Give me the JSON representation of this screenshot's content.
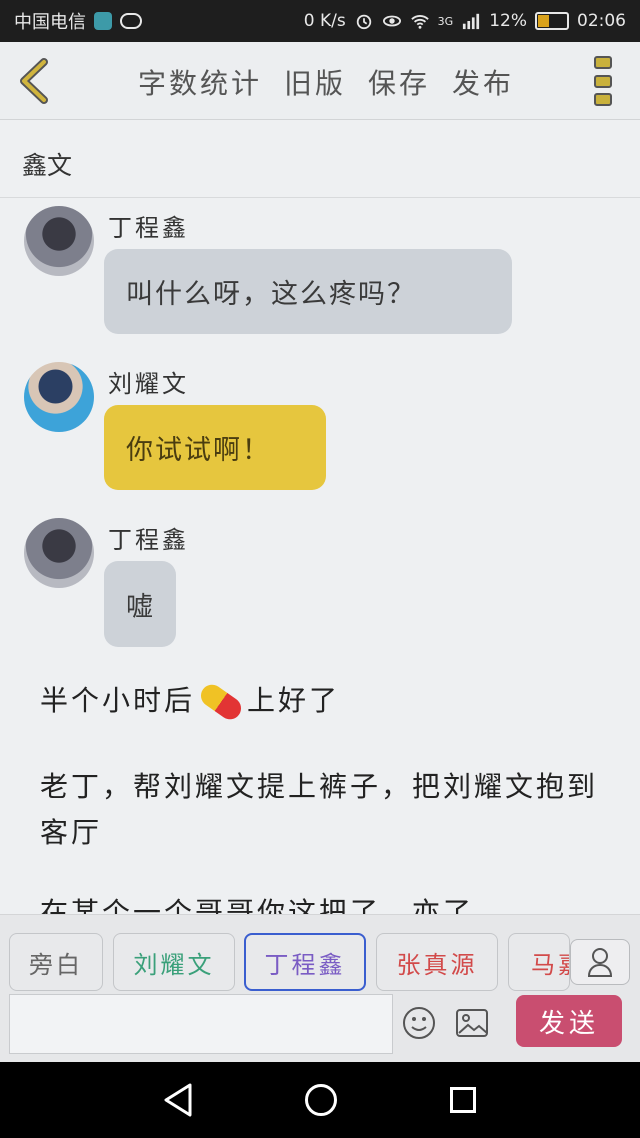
{
  "status_bar": {
    "carrier": "中国电信",
    "speed": "0 K/s",
    "network": "3G",
    "battery": "12%",
    "time": "02:06"
  },
  "header": {
    "actions": [
      "字数统计",
      "旧版",
      "保存",
      "发布"
    ]
  },
  "story_title": "鑫文",
  "messages": [
    {
      "sender": "丁程鑫",
      "text": "叫什么呀，这么疼吗？"
    },
    {
      "sender": "刘耀文",
      "text": "你试试啊！"
    },
    {
      "sender": "丁程鑫",
      "text": "嘘"
    }
  ],
  "narration": [
    {
      "before": "半个小时后",
      "after": "上好了"
    },
    {
      "text": "老丁，帮刘耀文提上裤子，把刘耀文抱到客厅"
    },
    {
      "text": "在某个一个哥哥你这把了，亦了"
    }
  ],
  "characters": [
    {
      "label": "旁白",
      "color": "#666666"
    },
    {
      "label": "刘耀文",
      "color": "#3aa07a"
    },
    {
      "label": "丁程鑫",
      "color": "#7a5cc4"
    },
    {
      "label": "张真源",
      "color": "#d24a4a"
    },
    {
      "label": "马嘉",
      "color": "#d24a4a"
    }
  ],
  "input": {
    "send_label": "发送"
  },
  "colors": {
    "send": "#c94e70",
    "bubble_other": "#cdd2d8",
    "bubble_self": "#e6c63e",
    "selected_tab_border": "#3a5ecf"
  }
}
